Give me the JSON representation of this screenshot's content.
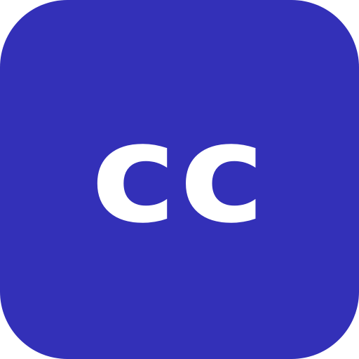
{
  "app_icon": {
    "label": "cc",
    "background_color": "#3330b8",
    "text_color": "#ffffff"
  }
}
